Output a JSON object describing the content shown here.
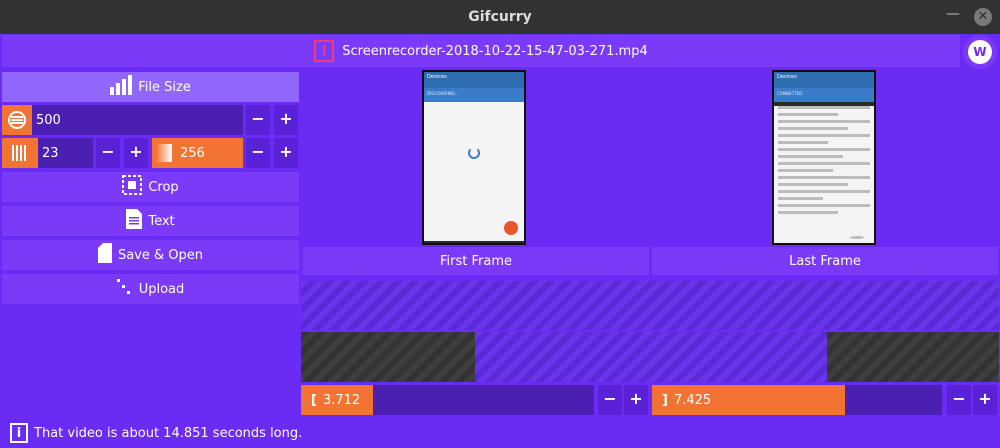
{
  "window": {
    "title": "Gifcurry",
    "close_glyph": "✕",
    "minimize_glyph": "—"
  },
  "file": {
    "name": "Screenrecorder-2018-10-22-15-47-03-271.mp4",
    "warning_icon": "warning-icon"
  },
  "logo": {
    "text": "W"
  },
  "sidebar": {
    "file_size_label": "File Size",
    "width_value": "500",
    "fps_value": "23",
    "colors_value": "256",
    "crop_label": "Crop",
    "text_label": "Text",
    "save_open_label": "Save & Open",
    "upload_label": "Upload",
    "minus": "−",
    "plus": "+"
  },
  "preview": {
    "first_frame_label": "First Frame",
    "last_frame_label": "Last Frame",
    "phone_title": "Devices",
    "phone_action": "DISCONNECT",
    "first_status": "DISCOVERING...",
    "last_status": "CONNECTED"
  },
  "timeline": {
    "start_value": "3.712",
    "end_value": "7.425",
    "minus": "−",
    "plus": "+"
  },
  "status": {
    "message": "That video is about 14.851 seconds long.",
    "icon": "info-icon",
    "icon_text": "i"
  },
  "colors": {
    "accent": "#6a2cf4",
    "button": "#7b3af8",
    "orange": "#f37332",
    "dark": "#333232"
  }
}
